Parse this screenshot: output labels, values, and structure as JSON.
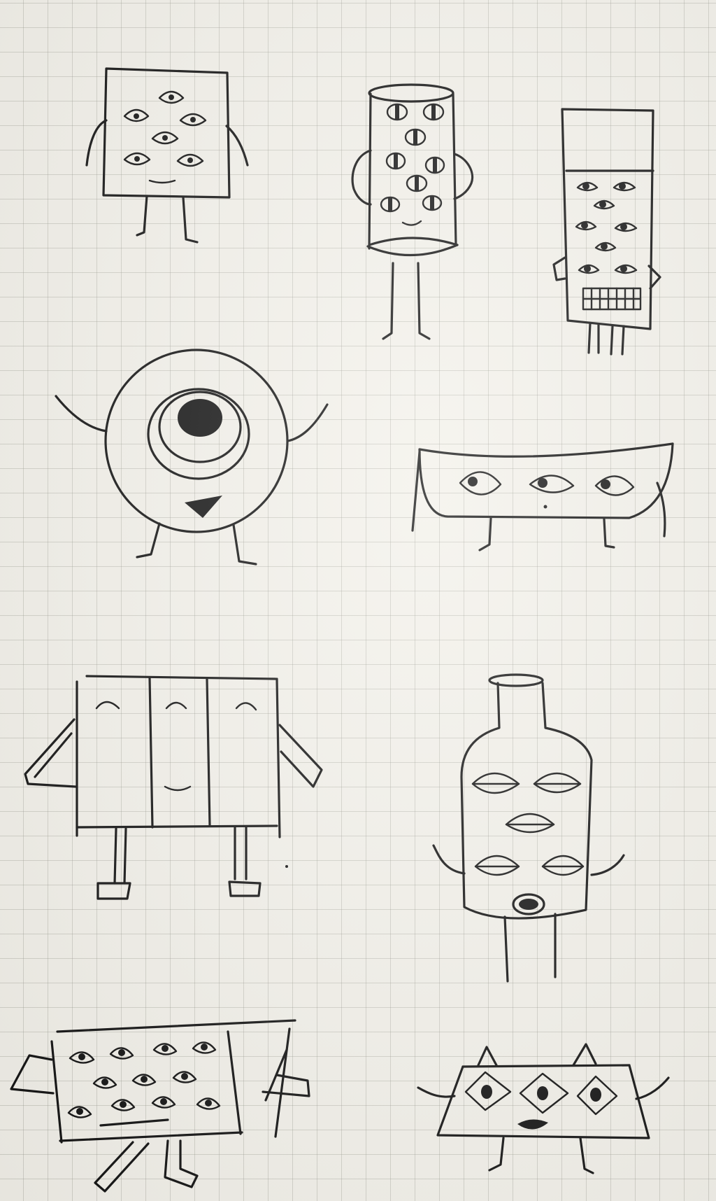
{
  "colors": {
    "paper": "#f3f1ea",
    "grid": "#b5b3a8",
    "ink": "#111111"
  },
  "doodles": [
    {
      "name": "square-monster-six-eyes",
      "kind": "hand-drawn-sketch"
    },
    {
      "name": "cylinder-monster-many-eyes",
      "kind": "hand-drawn-sketch"
    },
    {
      "name": "rectangle-monster-teeth",
      "kind": "hand-drawn-sketch"
    },
    {
      "name": "round-cyclops-monster",
      "kind": "hand-drawn-sketch"
    },
    {
      "name": "bowl-monster-three-eyes",
      "kind": "hand-drawn-sketch"
    },
    {
      "name": "three-panel-monster",
      "kind": "hand-drawn-sketch"
    },
    {
      "name": "bottle-monster",
      "kind": "hand-drawn-sketch"
    },
    {
      "name": "grater-monster",
      "kind": "hand-drawn-sketch"
    },
    {
      "name": "trapezoid-cat-monster",
      "kind": "hand-drawn-sketch"
    }
  ]
}
